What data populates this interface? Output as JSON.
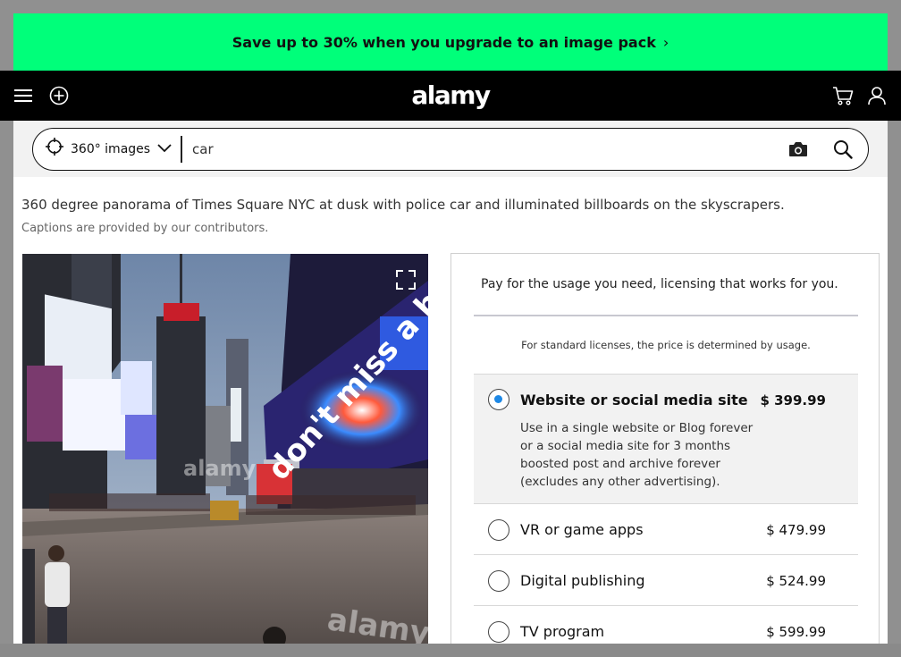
{
  "promo": {
    "text": "Save up to 30% when you upgrade to an image pack",
    "chevron": "›"
  },
  "header": {
    "logo": "alamy",
    "icons": [
      "hamburger-menu-icon",
      "add-circle-icon",
      "cart-icon",
      "user-icon"
    ]
  },
  "search": {
    "type_label": "360° images",
    "query": "car",
    "icons": [
      "crosshair-icon",
      "chevron-down-icon",
      "camera-icon",
      "search-icon"
    ]
  },
  "image": {
    "caption": "360 degree panorama of Times Square NYC at dusk with police car and illuminated billboards on the skyscrapers.",
    "caption_note": "Captions are provided by our contributors.",
    "billboard_text": "don't miss a beat",
    "watermark": "alamy"
  },
  "pricing": {
    "intro": "Pay for the usage you need, licensing that works for you.",
    "note": "For standard licenses, the price is determined by usage.",
    "options": [
      {
        "label": "Website or social media site",
        "price": "$ 399.99",
        "selected": true,
        "description": "Use in a single website or Blog forever or a social media site for 3 months boosted post and archive forever (excludes any other advertising)."
      },
      {
        "label": "VR or game apps",
        "price": "$ 479.99",
        "selected": false
      },
      {
        "label": "Digital publishing",
        "price": "$ 524.99",
        "selected": false
      },
      {
        "label": "TV program",
        "price": "$ 599.99",
        "selected": false
      }
    ]
  },
  "colors": {
    "promo_bg": "#00ff7a",
    "header_bg": "#000000",
    "radio_accent": "#1e88e5"
  }
}
